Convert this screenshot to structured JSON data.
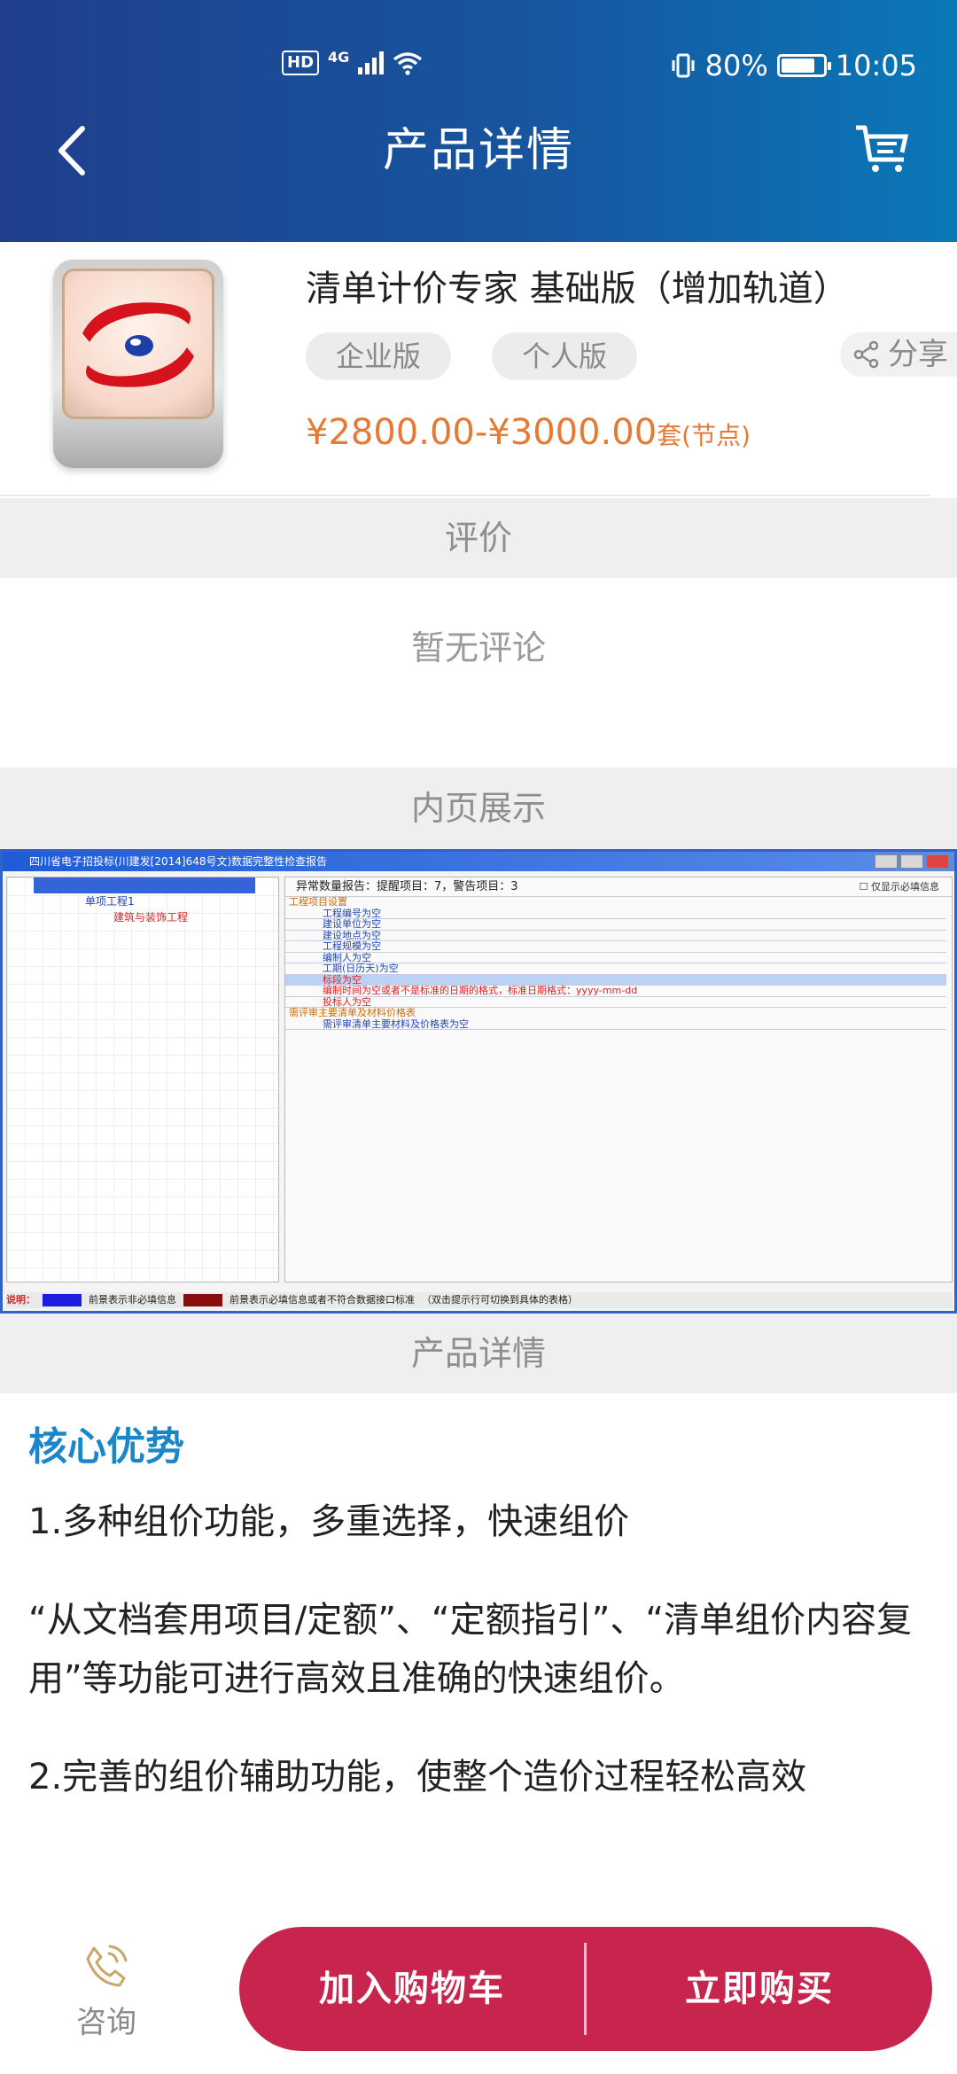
{
  "status_bar": {
    "hd": "HD",
    "network": "4G",
    "battery_percent": "80%",
    "battery_level": 0.8,
    "time": "10:05"
  },
  "header": {
    "title": "产品详情",
    "back_icon": "chevron-left-icon",
    "cart_icon": "cart-icon"
  },
  "product": {
    "name": "清单计价专家 基础版（增加轨道）",
    "tags": [
      "企业版",
      "个人版"
    ],
    "share_label": "分享",
    "price_range": "¥2800.00-¥3000.00",
    "price_unit": "套(节点)"
  },
  "sections": {
    "review_header": "评价",
    "no_review": "暂无评论",
    "inner_header": "内页展示",
    "detail_header": "产品详情"
  },
  "screenshot": {
    "window_title": "四川省电子招投标(川建发[2014]648号文)数据完整性检查报告",
    "tree": [
      "单项工程1",
      "建筑与装饰工程"
    ],
    "report_head": "异常数量报告：提醒项目：7，警告项目：3",
    "only_required": "仅显示必填信息",
    "category_1": "工程项目设置",
    "items": [
      "工程编号为空",
      "建设单位为空",
      "建设地点为空",
      "工程规模为空",
      "编制人为空",
      "工期(日历天)为空",
      "标段为空",
      "编制时间为空或者不是标准的日期的格式，标准日期格式：yyyy-mm-dd",
      "投标人为空"
    ],
    "category_2": "需评审主要清单及材料价格表",
    "items_2": [
      "需评审清单主要材料及价格表为空"
    ],
    "status_note": "说明：",
    "status_text_1": "前景表示非必填信息",
    "status_text_2": "前景表示必填信息或者不符合数据接口标准",
    "status_text_3": "（双击提示行可切换到具体的表格）",
    "colors": {
      "swatch_blue": "#1d1ddf",
      "swatch_red": "#8b0c0c"
    }
  },
  "detail": {
    "core_title": "核心优势",
    "point_1": "1.多种组价功能，多重选择，快速组价",
    "point_1_desc": "“从文档套用项目/定额”、“定额指引”、“清单组价内容复用”等功能可进行高效且准确的快速组价。",
    "point_2": "2.完善的组价辅助功能，使整个造价过程轻松高效"
  },
  "bottom": {
    "consult_label": "咨询",
    "consult_icon": "phone-icon",
    "add_cart_label": "加入购物车",
    "buy_now_label": "立即购买"
  },
  "colors": {
    "header_start": "#1f3f8c",
    "header_end": "#0a78b7",
    "price": "#e57a35",
    "accent_title": "#1b86c8",
    "primary_button": "#c7254e"
  }
}
